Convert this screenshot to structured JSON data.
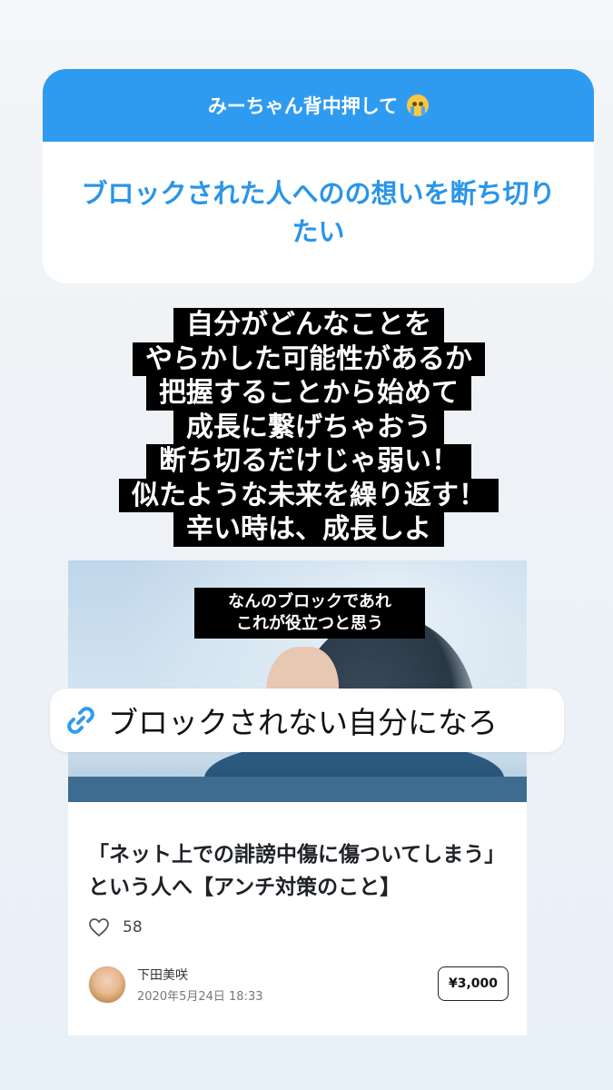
{
  "question_sticker": {
    "header": "みーちゃん背中押して",
    "header_emoji": "loudly-crying-face-emoji",
    "question": "ブロックされた人へのの想いを断ち切りたい",
    "colors": {
      "header_bg": "#2f9bf0",
      "question_text": "#2a95e8"
    }
  },
  "message_lines": [
    "自分がどんなことを",
    "やらかした可能性があるか",
    "把握することから始めて",
    "成長に繋げちゃおう",
    "断ち切るだけじゃ弱い！",
    "似たような未来を繰り返す！",
    "辛い時は、成長しよ"
  ],
  "article": {
    "thumbnail_caption": [
      "なんのブロックであれ",
      "これが役立つと思う"
    ],
    "title": "「ネット上での誹謗中傷に傷ついてしまう」という人へ【アンチ対策のこと】",
    "likes": "58",
    "author_name": "下田美咲",
    "date": "2020年5月24日 18:33",
    "price": "¥3,000"
  },
  "link_sticker": {
    "icon": "link-icon",
    "text": "ブロックされない自分になろ"
  }
}
